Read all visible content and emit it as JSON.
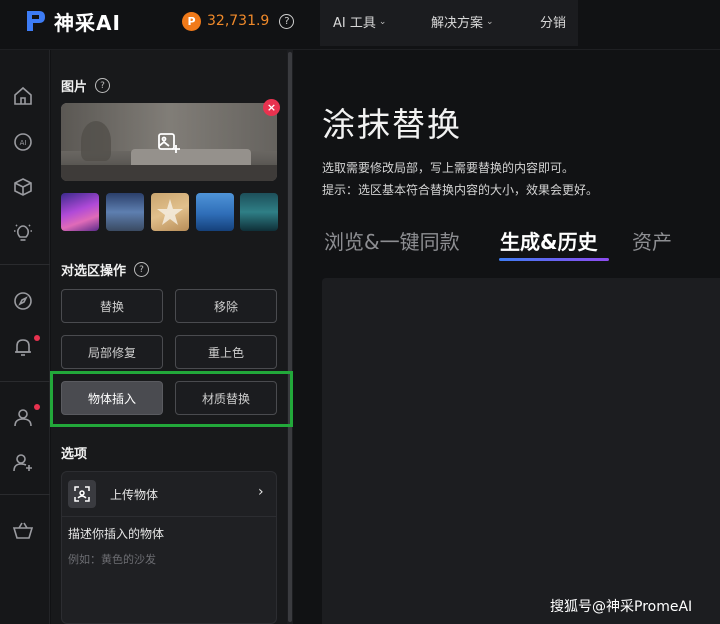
{
  "header": {
    "brand": "神采AI",
    "credits": "32,731.9",
    "nav": [
      {
        "label": "AI 工具",
        "has_dropdown": true
      },
      {
        "label": "解决方案",
        "has_dropdown": true
      },
      {
        "label": "分销",
        "has_dropdown": false
      }
    ]
  },
  "rail": {
    "icons": [
      "home-icon",
      "ai-icon",
      "cube-icon",
      "lightbulb-icon",
      "compass-icon",
      "bell-icon",
      "user-icon",
      "user-add-icon",
      "basket-icon"
    ],
    "notification_dots": [
      "bell-icon",
      "user-icon"
    ]
  },
  "panel": {
    "image_section": {
      "title": "图片"
    },
    "selection_section": {
      "title": "对选区操作",
      "buttons": [
        "替换",
        "移除",
        "局部修复",
        "重上色",
        "物体插入",
        "材质替换"
      ],
      "active": "物体插入"
    },
    "options_section": {
      "title": "选项",
      "upload_object_label": "上传物体",
      "describe_label": "描述你插入的物体",
      "describe_placeholder": "例如：黄色的沙发"
    }
  },
  "main": {
    "title": "涂抹替换",
    "description_1": "选取需要修改局部，写上需要替换的内容即可。",
    "description_2": "提示：选区基本符合替换内容的大小，效果会更好。",
    "tabs": [
      "浏览&一键同款",
      "生成&历史",
      "资产"
    ],
    "active_tab": "生成&历史"
  },
  "watermark": "搜狐号@神采PromeAI",
  "colors": {
    "accent_orange": "#f08a2a",
    "notification_red": "#e8324f",
    "highlight_green": "#22a83a",
    "tab_gradient_start": "#3f7cf2",
    "tab_gradient_end": "#8e4cf0"
  }
}
